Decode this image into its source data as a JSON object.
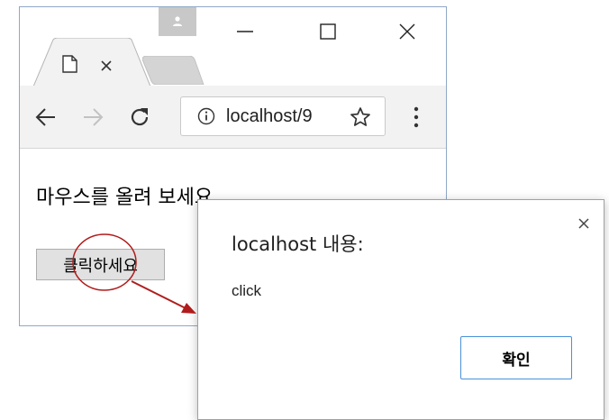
{
  "browser": {
    "address": "localhost/9",
    "colors": {
      "window_border": "#8fa8c6",
      "toolbar_bg": "#f2f2f2",
      "profile_bg": "#c8c8c8"
    }
  },
  "page": {
    "heading": "마우스를 올려 보세요",
    "button_label": "클릭하세요"
  },
  "dialog": {
    "title": "localhost 내용:",
    "message": "click",
    "ok_label": "확인",
    "accent": "#4a90d9"
  },
  "annotation": {
    "color": "#b01c1c"
  }
}
